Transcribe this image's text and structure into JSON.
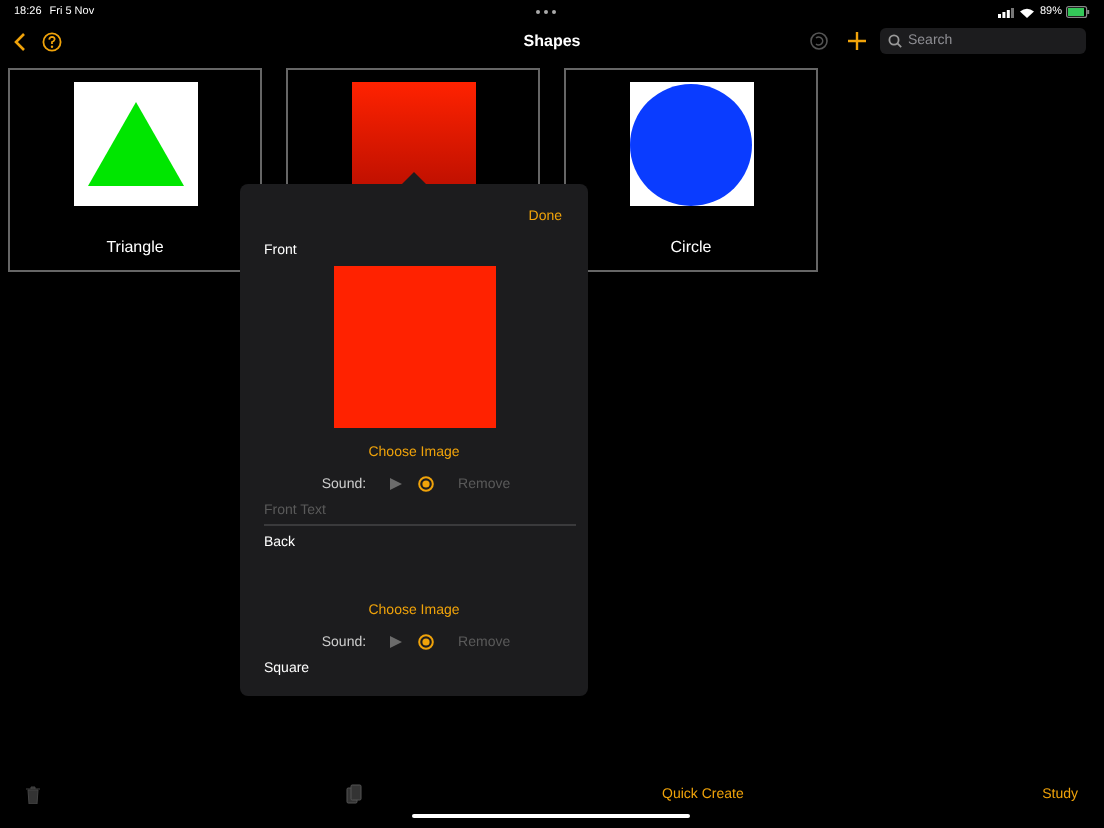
{
  "status_bar": {
    "time": "18:26",
    "date": "Fri 5 Nov",
    "battery": "89%"
  },
  "nav": {
    "title": "Shapes",
    "search": {
      "placeholder": "Search"
    }
  },
  "cards": [
    {
      "kind": "triangle",
      "label": "Triangle"
    },
    {
      "kind": "square"
    },
    {
      "kind": "circle",
      "label": "Circle"
    }
  ],
  "editor": {
    "done": "Done",
    "sides": [
      {
        "label": "Front",
        "has_image": true,
        "choose": "Choose Image",
        "sound_label": "Sound:",
        "remove": {
          "label": "Remove",
          "disabled": true
        },
        "text": {
          "placeholder": "Front Text"
        }
      },
      {
        "label": "Back",
        "has_image": false,
        "choose": "Choose Image",
        "sound_label": "Sound:",
        "remove": {
          "label": "Remove",
          "disabled": true
        },
        "text": {
          "value": "Square"
        }
      }
    ]
  },
  "toolbar": {
    "quick_create": "Quick Create",
    "study": "Study"
  }
}
